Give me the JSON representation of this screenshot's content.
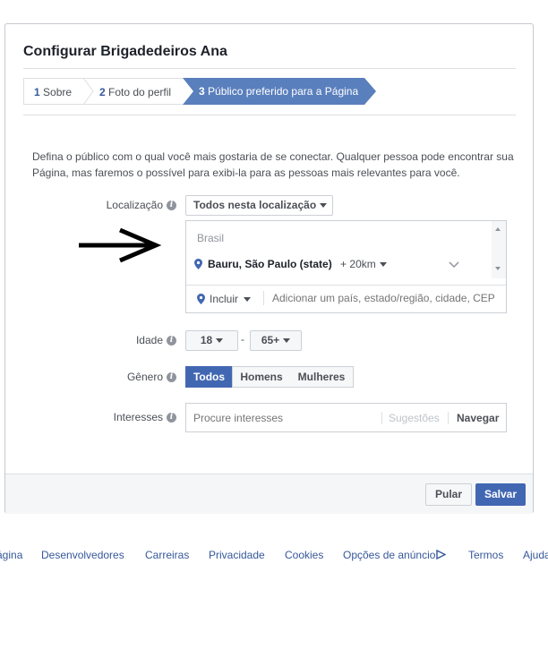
{
  "dialog": {
    "title": "Configurar Brigadedeiros Ana",
    "steps": [
      {
        "num": "1",
        "label": "Sobre"
      },
      {
        "num": "2",
        "label": "Foto do perfil"
      },
      {
        "num": "3",
        "label": "Público preferido para a Página"
      }
    ],
    "description": "Defina o público com o qual você mais gostaria de se conectar. Qualquer pessoa pode encontrar sua Página, mas faremos o possível para exibi-la para as pessoas mais relevantes para você.",
    "location": {
      "label": "Localização",
      "mode": "Todos nesta localização",
      "country": "Brasil",
      "place": "Bauru, São Paulo (state)",
      "radius": "+ 20km",
      "include": "Incluir",
      "placeholder": "Adicionar um país, estado/região, cidade, CEP"
    },
    "age": {
      "label": "Idade",
      "min": "18",
      "separator": "-",
      "max": "65+"
    },
    "gender": {
      "label": "Gênero",
      "options": [
        "Todos",
        "Homens",
        "Mulheres"
      ],
      "selected": "Todos"
    },
    "interests": {
      "label": "Interesses",
      "placeholder": "Procure interesses",
      "suggestions": "Sugestões",
      "browse": "Navegar"
    },
    "buttons": {
      "skip": "Pular",
      "save": "Salvar"
    },
    "info_icon": "i"
  },
  "footer_links": [
    "ágina",
    "Desenvolvedores",
    "Carreiras",
    "Privacidade",
    "Cookies",
    "Opções de anúncio",
    "Termos",
    "Ajuda"
  ],
  "colors": {
    "accent": "#4267b2",
    "link": "#365899",
    "step_active": "#5a7fbd"
  }
}
